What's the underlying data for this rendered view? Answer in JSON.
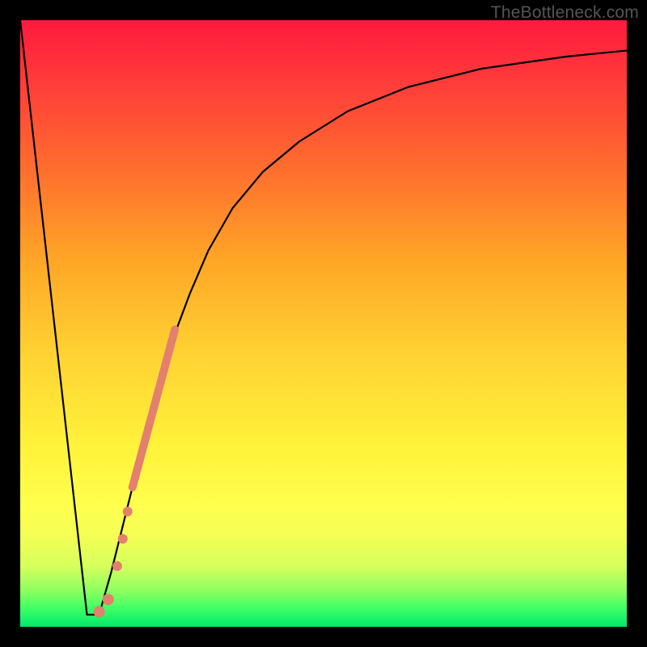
{
  "watermark": "TheBottleneck.com",
  "colors": {
    "curve": "#000000",
    "marker": "#e3806e",
    "frame": "#000000"
  },
  "chart_data": {
    "type": "line",
    "title": "",
    "xlabel": "",
    "ylabel": "",
    "xlim": [
      0,
      100
    ],
    "ylim": [
      0,
      100
    ],
    "series": [
      {
        "name": "left-spike",
        "x": [
          0,
          11,
          13
        ],
        "values": [
          100,
          2,
          2
        ]
      },
      {
        "name": "right-curve",
        "x": [
          13,
          15,
          17,
          19,
          21,
          23,
          25,
          28,
          31,
          35,
          40,
          46,
          54,
          64,
          76,
          90,
          100
        ],
        "values": [
          2,
          9,
          17,
          25,
          33,
          40,
          47,
          55,
          62,
          69,
          75,
          80,
          85,
          89,
          92,
          94,
          95
        ]
      }
    ],
    "markers": [
      {
        "name": "scatter-band",
        "type": "segment",
        "x1": 18.5,
        "y1": 23,
        "x2": 25.5,
        "y2": 49,
        "width": 10
      },
      {
        "name": "dot-1",
        "type": "dot",
        "x": 17.7,
        "y": 19,
        "r": 6
      },
      {
        "name": "dot-2",
        "type": "dot",
        "x": 16.9,
        "y": 14.5,
        "r": 6
      },
      {
        "name": "dot-3",
        "type": "dot",
        "x": 16.0,
        "y": 10,
        "r": 6
      },
      {
        "name": "dot-4",
        "type": "dot",
        "x": 14.5,
        "y": 4.5,
        "r": 7
      },
      {
        "name": "dot-5",
        "type": "dot",
        "x": 13.0,
        "y": 2.5,
        "r": 7
      }
    ]
  }
}
